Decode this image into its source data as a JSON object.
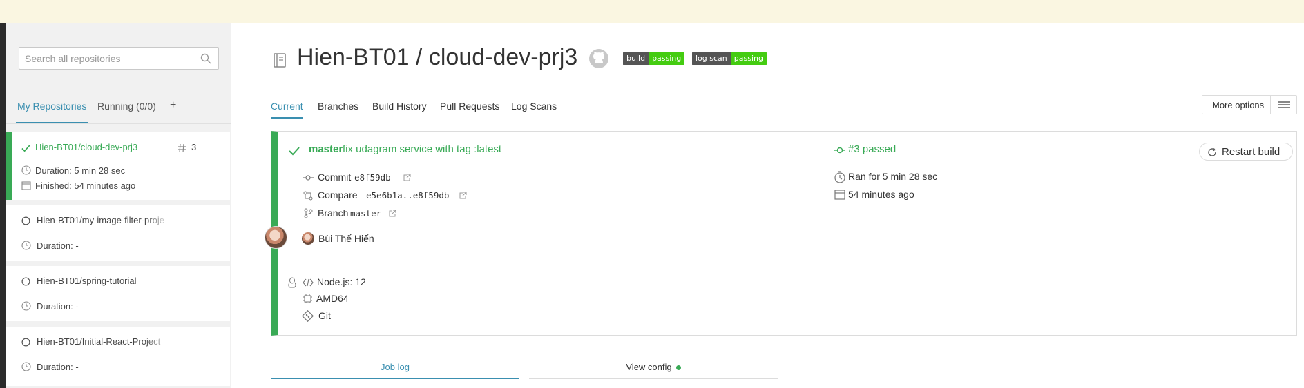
{
  "colors": {
    "accent": "#3a8fb0",
    "passed": "#39aa56",
    "banner": "#faf6e1"
  },
  "sidebar": {
    "search_placeholder": "Search all repositories",
    "tabs": [
      {
        "label": "My Repositories",
        "active": true
      },
      {
        "label": "Running (0/0)",
        "active": false
      }
    ],
    "add_label": "+",
    "repos": [
      {
        "name": "Hien-BT01/cloud-dev-prj3",
        "build_number": "3",
        "duration": "Duration: 5 min 28 sec",
        "finished": "Finished: 54 minutes ago",
        "status": "passed"
      },
      {
        "name": "Hien-BT01/my-image-filter-proje",
        "duration": "Duration: -",
        "status": "none"
      },
      {
        "name": "Hien-BT01/spring-tutorial",
        "duration": "Duration: -",
        "status": "none"
      },
      {
        "name": "Hien-BT01/Initial-React-Project",
        "duration": "Duration: -",
        "status": "none"
      }
    ]
  },
  "main": {
    "title": "Hien-BT01 / cloud-dev-prj3",
    "badges": [
      {
        "left": "build",
        "right": "passing"
      },
      {
        "left": "log scan",
        "right": "passing"
      }
    ],
    "tabs": [
      "Current",
      "Branches",
      "Build History",
      "Pull Requests",
      "Log Scans"
    ],
    "more_options": "More options",
    "build": {
      "branch": "master",
      "message": "fix udagram service with tag :latest",
      "number_status": "#3 passed",
      "restart_label": "Restart build",
      "commit_label": "Commit",
      "commit_hash": "e8f59db",
      "compare_label": "Compare",
      "compare_range": "e5e6b1a..e8f59db",
      "branch_label": "Branch",
      "branch_name": "master",
      "ran_for": "Ran for 5 min 28 sec",
      "time_ago": "54 minutes ago",
      "author": "Bùi Thế Hiển",
      "language": "Node.js: 12",
      "arch": "AMD64",
      "vcs": "Git"
    },
    "bottom_tabs": [
      {
        "label": "Job log",
        "active": true
      },
      {
        "label": "View config",
        "active": false
      }
    ]
  }
}
